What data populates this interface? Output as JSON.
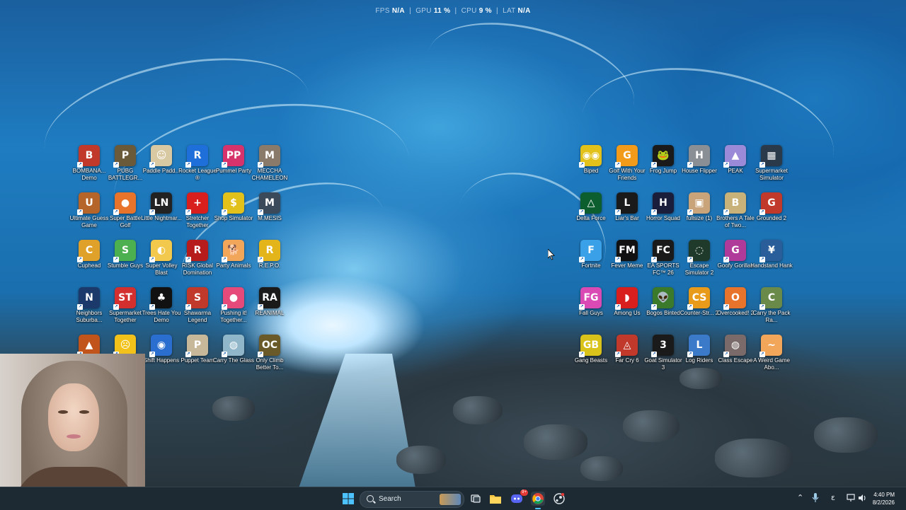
{
  "overlay": {
    "fps_label": "FPS",
    "fps_value": "N/A",
    "gpu_label": "GPU",
    "gpu_value": "11 %",
    "cpu_label": "CPU",
    "cpu_value": "9 %",
    "lat_label": "LAT",
    "lat_value": "N/A",
    "separator": "|"
  },
  "desktop_left": [
    {
      "label": "BOMBANA... Demo",
      "icon": "bombana-icon",
      "color": "#c0392b",
      "glyph": "B"
    },
    {
      "label": "PUBG BATTLEGR...",
      "icon": "pubg-icon",
      "color": "#6b5a3a",
      "glyph": "P"
    },
    {
      "label": "Paddle Padd...",
      "icon": "paddle-icon",
      "color": "#d9c9a3",
      "glyph": "☺"
    },
    {
      "label": "Rocket League ®",
      "icon": "rocket-league-icon",
      "color": "#1e6fd9",
      "glyph": "R"
    },
    {
      "label": "Pummel Party",
      "icon": "pummel-party-icon",
      "color": "#d6336c",
      "glyph": "PP"
    },
    {
      "label": "MECCHA CHAMELEON",
      "icon": "chameleon-icon",
      "color": "#8a7a6a",
      "glyph": "M"
    },
    {
      "label": "Ultimate Guess Game",
      "icon": "guess-game-icon",
      "color": "#b5652a",
      "glyph": "U"
    },
    {
      "label": "Super Battle Golf",
      "icon": "battle-golf-icon",
      "color": "#e8742c",
      "glyph": "●"
    },
    {
      "label": "Little Nightmar...",
      "icon": "little-nightmares-icon",
      "color": "#222222",
      "glyph": "LN"
    },
    {
      "label": "Stretcher Together",
      "icon": "stretcher-icon",
      "color": "#d91e1e",
      "glyph": "+"
    },
    {
      "label": "Shop Simulator",
      "icon": "shop-simulator-icon",
      "color": "#e2c21a",
      "glyph": "$"
    },
    {
      "label": "M.MESIS",
      "icon": "mmesis-icon",
      "color": "#3a4a5a",
      "glyph": "M"
    },
    {
      "label": "Cuphead",
      "icon": "cuphead-icon",
      "color": "#e0a12a",
      "glyph": "C"
    },
    {
      "label": "Stumble Guys",
      "icon": "stumble-guys-icon",
      "color": "#4caf50",
      "glyph": "S"
    },
    {
      "label": "Super Volley Blast",
      "icon": "volley-blast-icon",
      "color": "#f2c94c",
      "glyph": "◐"
    },
    {
      "label": "RISK Global Domination",
      "icon": "risk-icon",
      "color": "#b71c1c",
      "glyph": "R"
    },
    {
      "label": "Party Animals",
      "icon": "party-animals-icon",
      "color": "#f2a65a",
      "glyph": "🐕"
    },
    {
      "label": "R.E.P.O.",
      "icon": "repo-icon",
      "color": "#e3b51a",
      "glyph": "R"
    },
    {
      "label": "Neighbors Suburba...",
      "icon": "neighbors-icon",
      "color": "#1b3a6b",
      "glyph": "N"
    },
    {
      "label": "Supermarket Together",
      "icon": "supermarket-together-icon",
      "color": "#d32f2f",
      "glyph": "ST"
    },
    {
      "label": "Trees Hate You Demo",
      "icon": "trees-hate-icon",
      "color": "#111111",
      "glyph": "♣"
    },
    {
      "label": "Shawarma Legend",
      "icon": "shawarma-icon",
      "color": "#c0392b",
      "glyph": "S"
    },
    {
      "label": "Pushing it! Together...",
      "icon": "pushing-it-icon",
      "color": "#e64a7a",
      "glyph": "●"
    },
    {
      "label": "REANIMAL",
      "icon": "reanimal-icon",
      "color": "#1a1a1a",
      "glyph": "RA"
    },
    {
      "label": "",
      "icon": "orange-game-icon",
      "color": "#c0541a",
      "glyph": "▲"
    },
    {
      "label": "",
      "icon": "screaming-face-icon",
      "color": "#f2c21a",
      "glyph": "☹"
    },
    {
      "label": "Shift Happens",
      "icon": "shift-happens-icon",
      "color": "#2a6fd0",
      "glyph": "◉"
    },
    {
      "label": "Puppet Team",
      "icon": "puppet-team-icon",
      "color": "#c8b89a",
      "glyph": "P"
    },
    {
      "label": "Carry The Glass",
      "icon": "carry-glass-icon",
      "color": "#8fb7c9",
      "glyph": "◍"
    },
    {
      "label": "Only Climb Better To...",
      "icon": "only-climb-icon",
      "color": "#6a5a2a",
      "glyph": "OC"
    }
  ],
  "desktop_right": [
    {
      "label": "Biped",
      "icon": "biped-icon",
      "color": "#e2c21a",
      "glyph": "◉◉"
    },
    {
      "label": "Golf With Your Friends",
      "icon": "golf-friends-icon",
      "color": "#f29a1a",
      "glyph": "G"
    },
    {
      "label": "Frog Jump",
      "icon": "frog-jump-icon",
      "color": "#1a1a1a",
      "glyph": "🐸"
    },
    {
      "label": "House Flipper",
      "icon": "house-flipper-icon",
      "color": "#8a8f96",
      "glyph": "H"
    },
    {
      "label": "PEAK",
      "icon": "peak-icon",
      "color": "#9b8ad8",
      "glyph": "▲"
    },
    {
      "label": "Supermarket Simulator",
      "icon": "supermarket-simulator-icon",
      "color": "#2a3a4a",
      "glyph": "▦"
    },
    {
      "label": "Delta Force",
      "icon": "delta-force-icon",
      "color": "#0d5e2e",
      "glyph": "△"
    },
    {
      "label": "Liar's Bar",
      "icon": "liars-bar-icon",
      "color": "#1a1a1a",
      "glyph": "L"
    },
    {
      "label": "Horror Squad",
      "icon": "horror-squad-icon",
      "color": "#1a1e3a",
      "glyph": "H"
    },
    {
      "label": "fullsize (1)",
      "icon": "fullsize-image-icon",
      "color": "#c9a47a",
      "glyph": "▣"
    },
    {
      "label": "Brothers A Tale of Two...",
      "icon": "brothers-icon",
      "color": "#c9b27a",
      "glyph": "B"
    },
    {
      "label": "Grounded 2",
      "icon": "grounded-2-icon",
      "color": "#c0392b",
      "glyph": "G"
    },
    {
      "label": "Fortnite",
      "icon": "fortnite-icon",
      "color": "#3aa0e8",
      "glyph": "F"
    },
    {
      "label": "Fever Meme",
      "icon": "fever-meme-icon",
      "color": "#111111",
      "glyph": "FM"
    },
    {
      "label": "EA SPORTS FC™ 26",
      "icon": "ea-fc-icon",
      "color": "#1a1a1a",
      "glyph": "FC"
    },
    {
      "label": "Escape Simulator 2",
      "icon": "escape-simulator-icon",
      "color": "#1f3a2a",
      "glyph": "◌"
    },
    {
      "label": "Goofy Gorillas",
      "icon": "goofy-gorillas-icon",
      "color": "#b03a9a",
      "glyph": "G"
    },
    {
      "label": "Handstand Hank",
      "icon": "handstand-hank-icon",
      "color": "#2a5e9a",
      "glyph": "¥"
    },
    {
      "label": "Fall Guys",
      "icon": "fall-guys-icon",
      "color": "#d94ab5",
      "glyph": "FG"
    },
    {
      "label": "Among Us",
      "icon": "among-us-icon",
      "color": "#d91e1e",
      "glyph": "◗"
    },
    {
      "label": "Bogos Binted",
      "icon": "bogos-binted-icon",
      "color": "#3a7a2a",
      "glyph": "👽"
    },
    {
      "label": "Counter-Str... 2",
      "icon": "counter-strike-icon",
      "color": "#e89a1a",
      "glyph": "CS"
    },
    {
      "label": "Overcooked! 2",
      "icon": "overcooked-icon",
      "color": "#e8742c",
      "glyph": "O"
    },
    {
      "label": "Carry the Pack Ra...",
      "icon": "carry-pack-icon",
      "color": "#6a8a4a",
      "glyph": "C"
    },
    {
      "label": "Gang Beasts",
      "icon": "gang-beasts-icon",
      "color": "#d9c21a",
      "glyph": "GB"
    },
    {
      "label": "Far Cry 6",
      "icon": "far-cry-icon",
      "color": "#c0392b",
      "glyph": "◬"
    },
    {
      "label": "Goat Simulator 3",
      "icon": "goat-simulator-icon",
      "color": "#1a1a1a",
      "glyph": "3"
    },
    {
      "label": "Log Riders",
      "icon": "log-riders-icon",
      "color": "#3a7ac9",
      "glyph": "L"
    },
    {
      "label": "Class Escape",
      "icon": "class-escape-icon",
      "color": "#7a6a6a",
      "glyph": "◍"
    },
    {
      "label": "A Weird Game Abo...",
      "icon": "weird-game-icon",
      "color": "#f2a65a",
      "glyph": "~"
    }
  ],
  "taskbar": {
    "search_placeholder": "Search",
    "clock_time": "4:40 PM",
    "clock_date": "8/2/2026",
    "input_indicator": "ε",
    "discord_badge": "9+",
    "accent": "#1e2a33"
  },
  "webcam": {
    "visible": true
  }
}
